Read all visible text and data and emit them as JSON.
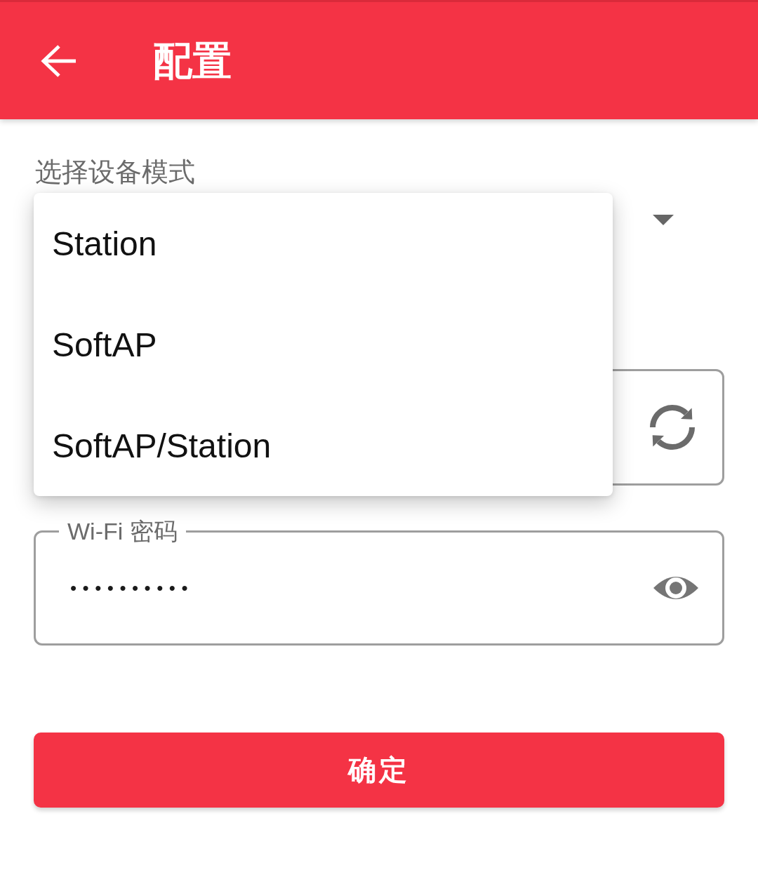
{
  "app_bar": {
    "title": "配置"
  },
  "mode_select": {
    "label": "选择设备模式",
    "expanded": true,
    "options": [
      {
        "label": "Station",
        "selected": false
      },
      {
        "label": "SoftAP",
        "selected": false
      },
      {
        "label": "SoftAP/Station",
        "selected": false
      }
    ]
  },
  "password_field": {
    "label": "Wi-Fi 密码",
    "value": "••••••••••"
  },
  "confirm_button": {
    "label": "确定"
  }
}
